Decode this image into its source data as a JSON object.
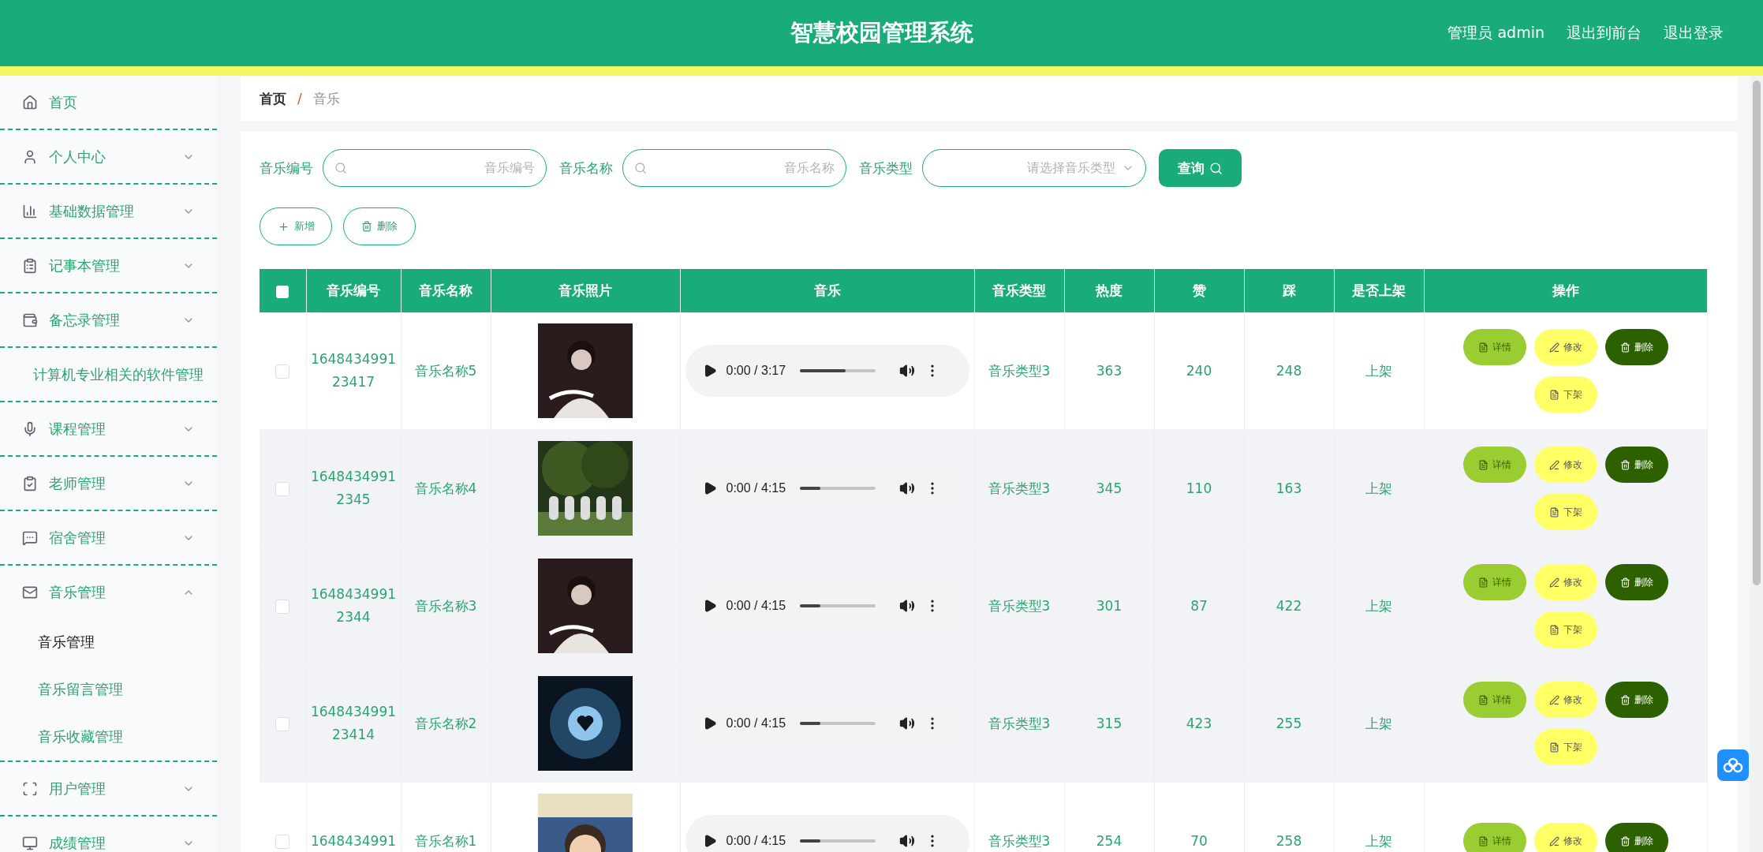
{
  "header": {
    "title": "智慧校园管理系统",
    "links": [
      "管理员 admin",
      "退出到前台",
      "退出登录"
    ]
  },
  "sidebar": {
    "items": [
      {
        "label": "首页"
      },
      {
        "label": "个人中心",
        "expanded": false
      },
      {
        "label": "基础数据管理",
        "expanded": false
      },
      {
        "label": "记事本管理",
        "expanded": false
      },
      {
        "label": "备忘录管理",
        "expanded": false
      },
      {
        "label": "计算机专业相关的软件管理"
      },
      {
        "label": "课程管理",
        "expanded": false
      },
      {
        "label": "老师管理",
        "expanded": false
      },
      {
        "label": "宿舍管理",
        "expanded": false
      },
      {
        "label": "音乐管理",
        "expanded": true,
        "children": [
          {
            "label": "音乐管理",
            "selected": true
          },
          {
            "label": "音乐留言管理",
            "selected": false
          },
          {
            "label": "音乐收藏管理",
            "selected": false
          }
        ]
      },
      {
        "label": "用户管理",
        "expanded": false
      },
      {
        "label": "成绩管理",
        "expanded": false
      }
    ]
  },
  "breadcrumb": {
    "items": [
      "首页",
      "音乐"
    ],
    "separator": "/"
  },
  "search": {
    "fields": [
      {
        "label": "音乐编号",
        "placeholder": "音乐编号",
        "kind": "text"
      },
      {
        "label": "音乐名称",
        "placeholder": "音乐名称",
        "kind": "text"
      },
      {
        "label": "音乐类型",
        "placeholder": "请选择音乐类型",
        "kind": "select"
      }
    ],
    "button": "查询"
  },
  "actions": [
    "新增",
    "删除"
  ],
  "table": {
    "select_all_checked": false,
    "columns": [
      "音乐编号",
      "音乐名称",
      "音乐照片",
      "音乐",
      "音乐类型",
      "热度",
      "赞",
      "踩",
      "是否上架",
      "操作"
    ],
    "rows": [
      {
        "checked": false,
        "highlighted": false,
        "id": [
          "1648434991",
          "23417"
        ],
        "name": "音乐名称5",
        "photo": {
          "kind": "picture"
        },
        "audio": {
          "time": "0:00 / 3:17",
          "level": 0.6
        },
        "type": "音乐类型3",
        "heat": "363",
        "likes": "240",
        "dislikes": "248",
        "status": "上架",
        "buttons": [
          "详情",
          "修改",
          "删除",
          "下架"
        ]
      },
      {
        "checked": false,
        "highlighted": true,
        "id": [
          "1648434991",
          "2345"
        ],
        "name": "音乐名称4",
        "photo": {
          "kind": "picture"
        },
        "audio": {
          "time": "0:00 / 4:15",
          "level": 0.27
        },
        "type": "音乐类型3",
        "heat": "345",
        "likes": "110",
        "dislikes": "163",
        "status": "上架",
        "buttons": [
          "详情",
          "修改",
          "删除",
          "下架"
        ]
      },
      {
        "checked": false,
        "highlighted": true,
        "id": [
          "1648434991",
          "2344"
        ],
        "name": "音乐名称3",
        "photo": {
          "kind": "picture"
        },
        "audio": {
          "time": "0:00 / 4:15",
          "level": 0.27
        },
        "type": "音乐类型3",
        "heat": "301",
        "likes": "87",
        "dislikes": "422",
        "status": "上架",
        "buttons": [
          "详情",
          "修改",
          "删除",
          "下架"
        ]
      },
      {
        "checked": false,
        "highlighted": true,
        "id": [
          "1648434991",
          "23414"
        ],
        "name": "音乐名称2",
        "photo": {
          "kind": "picture"
        },
        "audio": {
          "time": "0:00 / 4:15",
          "level": 0.27
        },
        "type": "音乐类型3",
        "heat": "315",
        "likes": "423",
        "dislikes": "255",
        "status": "上架",
        "buttons": [
          "详情",
          "修改",
          "删除",
          "下架"
        ]
      },
      {
        "checked": false,
        "highlighted": false,
        "id": [
          "1648434991"
        ],
        "name": "音乐名称1",
        "photo": {
          "kind": "picture"
        },
        "audio": {
          "time": "0:00 / 4:15",
          "level": 0.27
        },
        "type": "音乐类型3",
        "heat": "254",
        "likes": "70",
        "dislikes": "258",
        "status": "上架",
        "buttons": [
          "详情",
          "修改",
          "删除"
        ]
      }
    ]
  }
}
